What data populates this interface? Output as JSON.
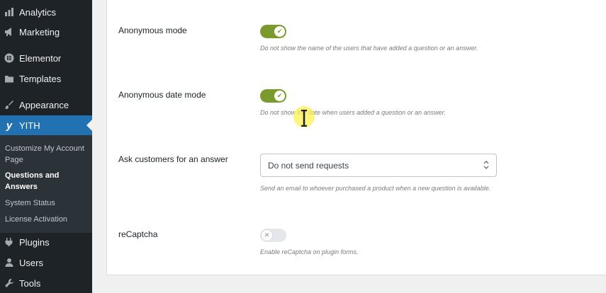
{
  "sidebar": {
    "items": [
      {
        "label": "Analytics",
        "icon": "bar-chart-icon"
      },
      {
        "label": "Marketing",
        "icon": "megaphone-icon"
      },
      {
        "label": "Elementor",
        "icon": "elementor-icon"
      },
      {
        "label": "Templates",
        "icon": "folder-icon"
      },
      {
        "label": "Appearance",
        "icon": "paintbrush-icon"
      },
      {
        "label": "YITH",
        "icon": "yith-icon",
        "active": true
      },
      {
        "label": "Plugins",
        "icon": "plug-icon"
      },
      {
        "label": "Users",
        "icon": "user-icon"
      },
      {
        "label": "Tools",
        "icon": "wrench-icon"
      }
    ],
    "submenu": [
      {
        "label": "Customize My Account Page"
      },
      {
        "label": "Questions and Answers",
        "current": true
      },
      {
        "label": "System Status"
      },
      {
        "label": "License Activation"
      }
    ]
  },
  "settings": {
    "anonymous_mode": {
      "label": "Anonymous mode",
      "enabled": true,
      "description": "Do not show the name of the users that have added a question or an answer."
    },
    "anonymous_date_mode": {
      "label": "Anonymous date mode",
      "enabled": true,
      "description": "Do not show the date when users added a question or an answer."
    },
    "ask_customers": {
      "label": "Ask customers for an answer",
      "selected": "Do not send requests",
      "description": "Send an email to whoever purchased a product when a new question is available."
    },
    "recaptcha": {
      "label": "reCaptcha",
      "enabled": false,
      "description": "Enable reCaptcha on plugin forms."
    }
  },
  "colors": {
    "sidebar_bg": "#1d2327",
    "active_menu": "#2271b1",
    "toggle_on": "#7b9a2e",
    "toggle_off": "#e6e7ea"
  }
}
